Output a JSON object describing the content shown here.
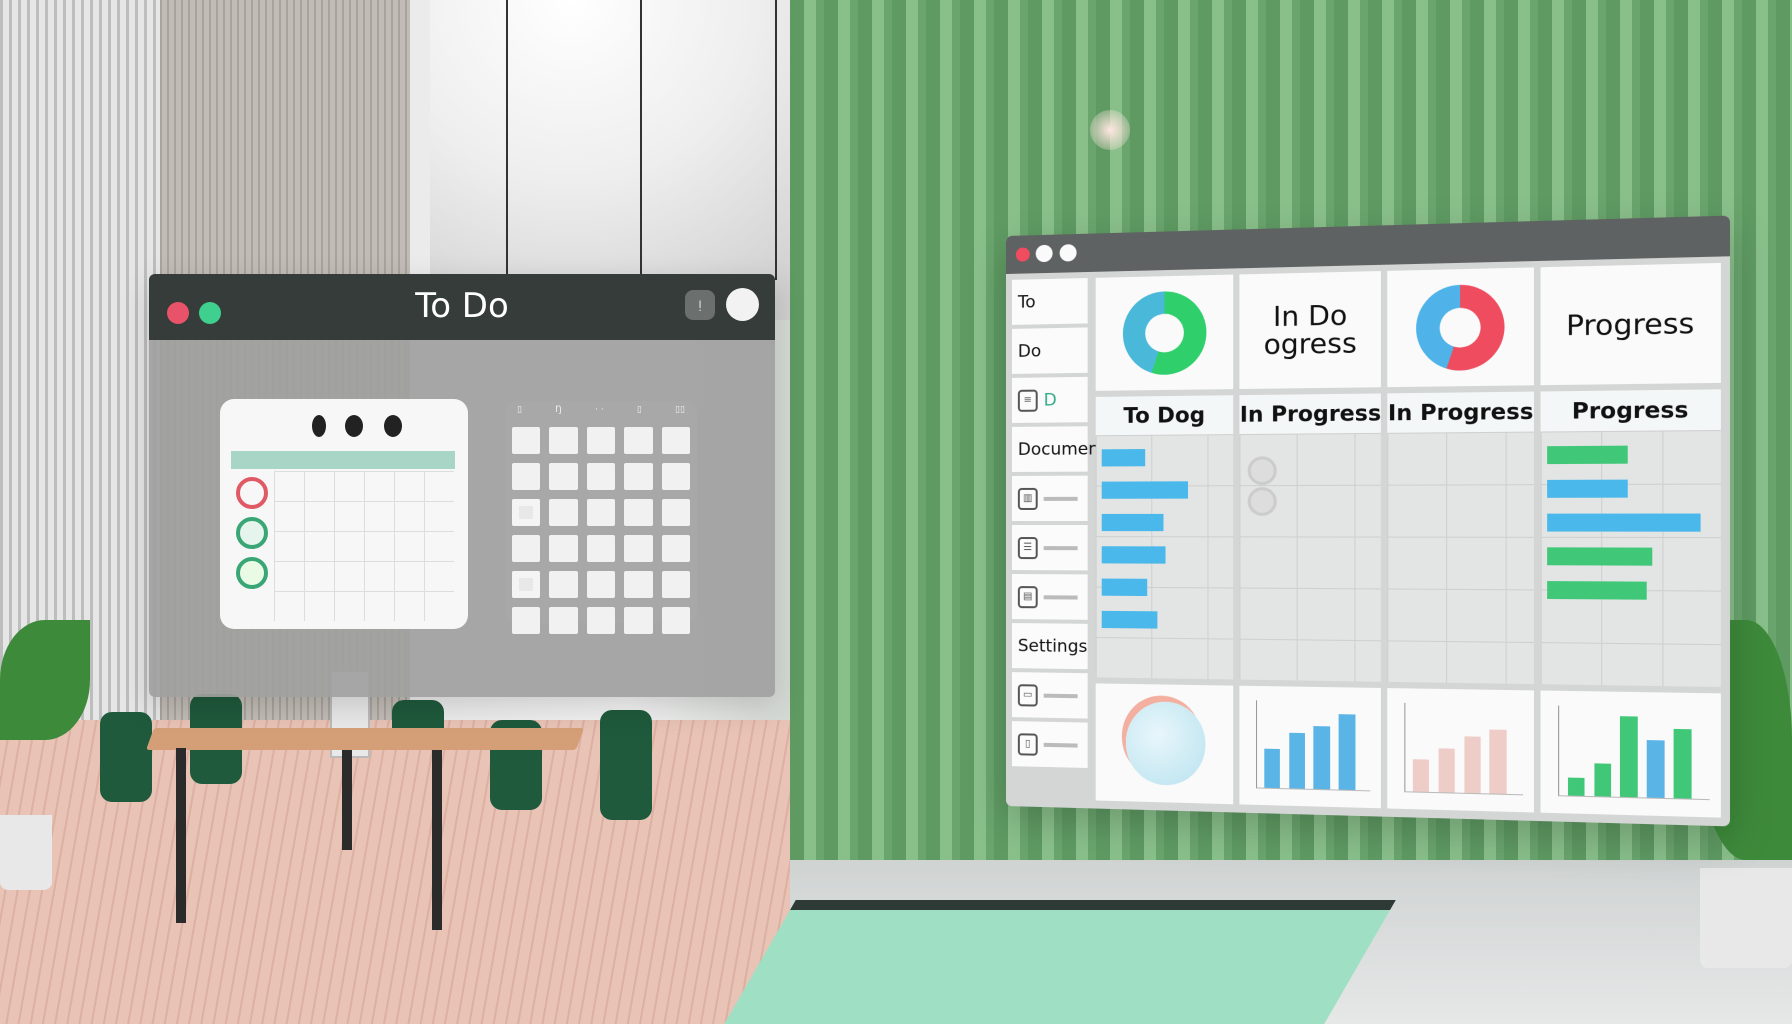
{
  "left_window": {
    "title": "To Do",
    "icon_button_label": "ᴉ",
    "traffic_colors": [
      "#e9536a",
      "#3fcf8e"
    ],
    "calendar": {
      "status_rings": [
        "#e05a66",
        "#3aa676",
        "#3aa676"
      ],
      "accent_band": "#a9d5c6"
    },
    "tile_grid": {
      "header_glyphs": [
        "▯",
        "Ŋ",
        "· ·",
        "▯",
        "▯▯"
      ],
      "rows": 6,
      "cols": 5
    }
  },
  "right_window": {
    "sidebar": [
      {
        "label": "To",
        "icon": null
      },
      {
        "label": "Do",
        "icon": null
      },
      {
        "label": "D",
        "icon": "document-icon"
      },
      {
        "label": "Document",
        "icon": null
      },
      {
        "label": "",
        "icon": "chart-icon"
      },
      {
        "label": "",
        "icon": "list-icon"
      },
      {
        "label": "",
        "icon": "file-icon"
      },
      {
        "label": "Settings",
        "icon": null
      },
      {
        "label": "",
        "icon": "save-icon"
      },
      {
        "label": "",
        "icon": "folder-icon"
      }
    ],
    "top_cards": [
      {
        "type": "donut",
        "colors": [
          "#2fcf6c",
          "#4ab8d8"
        ]
      },
      {
        "type": "text",
        "lines": [
          "In Do",
          "ogress"
        ]
      },
      {
        "type": "donut",
        "colors": [
          "#ef4c60",
          "#4fb3ea"
        ]
      },
      {
        "type": "text",
        "lines": [
          "Progress"
        ]
      }
    ],
    "columns": [
      {
        "header": "To Dog",
        "bars": [
          {
            "fill": 0.35,
            "color": "#4ab8ea"
          },
          {
            "fill": 0.7,
            "color": "#4ab8ea"
          },
          {
            "fill": 0.5,
            "color": "#4ab8ea"
          },
          {
            "fill": 0.52,
            "color": "#4ab8ea"
          },
          {
            "fill": 0.37,
            "color": "#4ab8ea"
          },
          {
            "fill": 0.45,
            "color": "#4ab8ea"
          }
        ]
      },
      {
        "header": "In Progress",
        "bars": []
      },
      {
        "header": "In Progress",
        "bars": []
      },
      {
        "header": "Progress",
        "bars": [
          {
            "fill": 0.5,
            "color": "#40c878"
          },
          {
            "fill": 0.5,
            "color": "#4ab8ea"
          },
          {
            "fill": 0.95,
            "color": "#4ab8ea"
          },
          {
            "fill": 0.65,
            "color": "#40c878"
          },
          {
            "fill": 0.62,
            "color": "#40c878"
          }
        ]
      }
    ],
    "bottom_charts": [
      {
        "type": "illustration"
      },
      {
        "type": "bar",
        "values": [
          0.5,
          0.7,
          0.8,
          0.95
        ],
        "color": "#5ab4e6"
      },
      {
        "type": "area",
        "values": [
          0.4,
          0.55,
          0.7,
          0.8
        ],
        "color": "#e8b8b0"
      },
      {
        "type": "bar",
        "values": [
          0.22,
          0.4,
          1.0,
          0.7,
          0.85
        ],
        "colors": [
          "#40c878",
          "#40c878",
          "#40c878",
          "#5ab4e6",
          "#40c878"
        ]
      }
    ]
  }
}
